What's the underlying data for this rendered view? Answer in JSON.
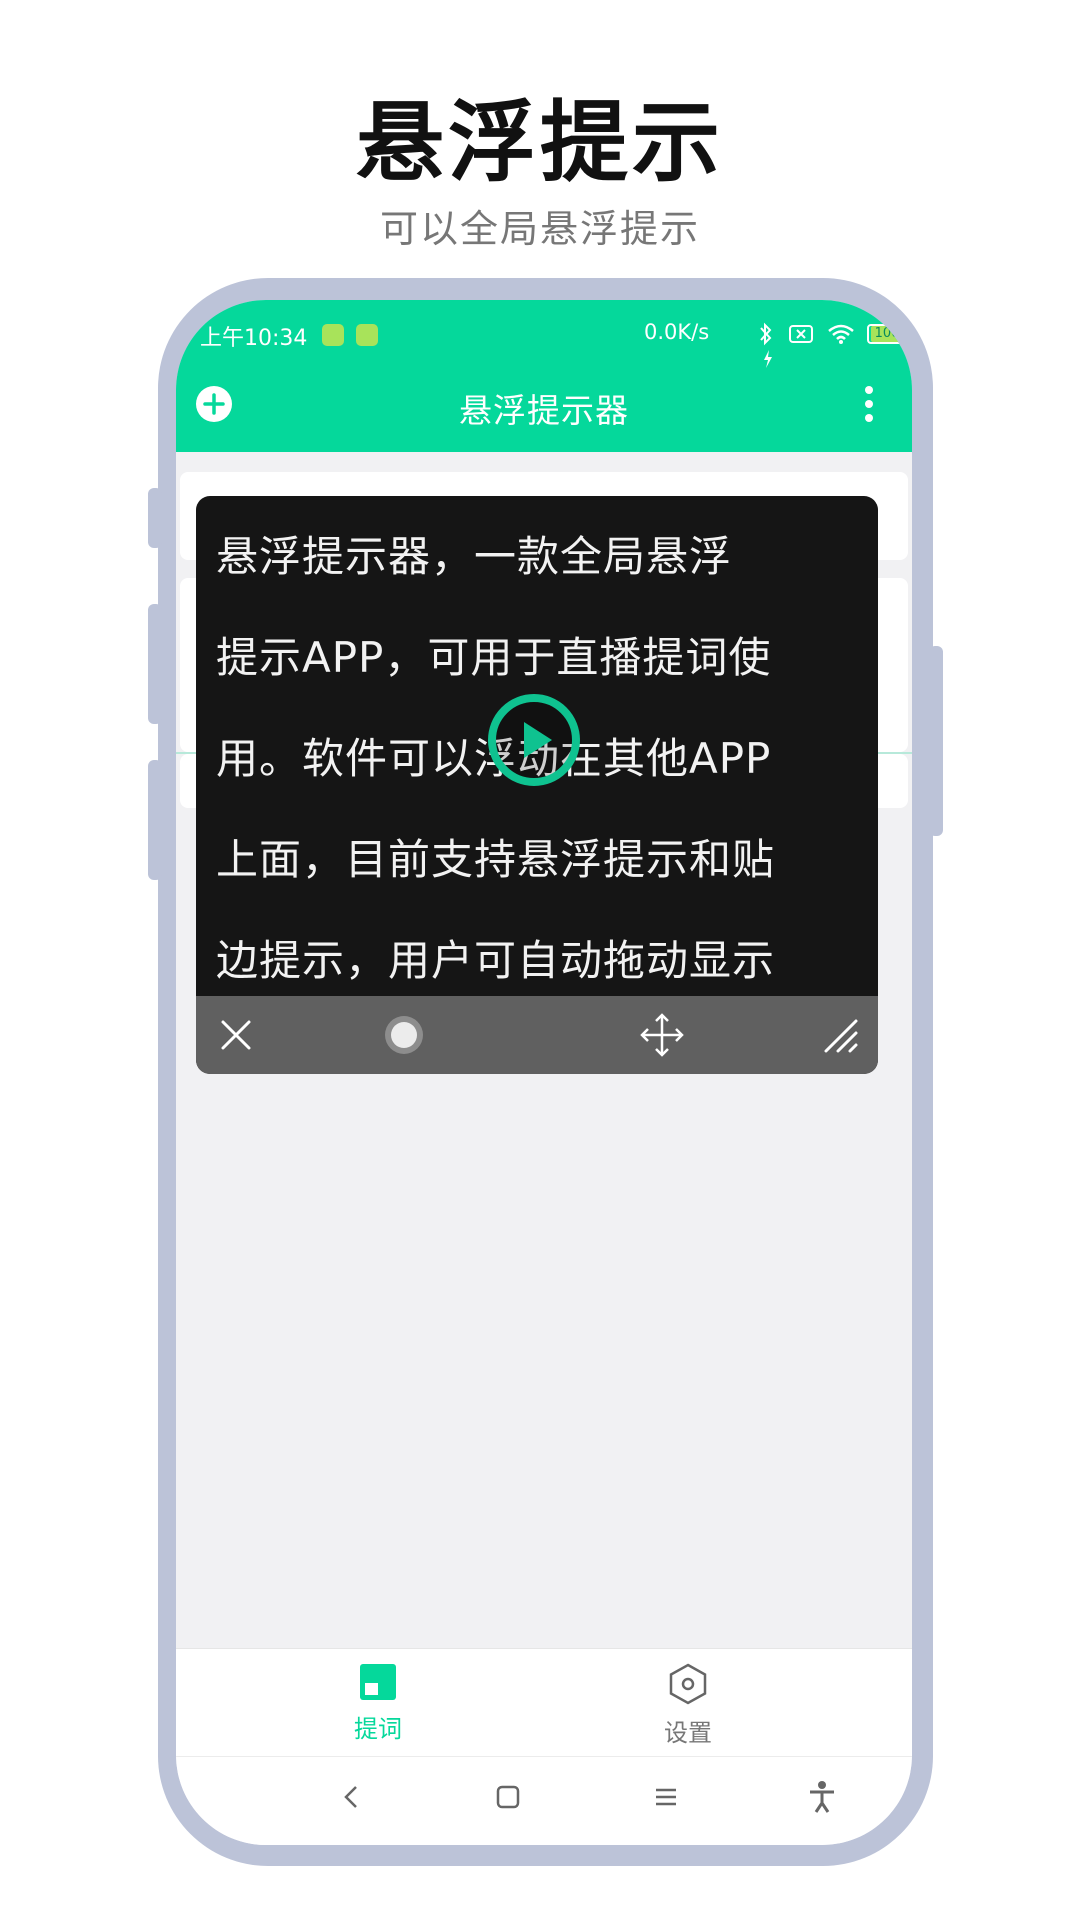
{
  "headline": "悬浮提示",
  "subline": "可以全局悬浮提示",
  "status_bar": {
    "time": "上午10:34",
    "network_speed": "0.0K/s",
    "battery": "100",
    "icons": [
      "bot-icon",
      "bot-icon",
      "bluetooth-icon",
      "sim-off-icon",
      "wifi-icon",
      "battery-icon",
      "charging-icon"
    ]
  },
  "app_bar": {
    "title": "悬浮提示器",
    "add_icon": "plus-circle-icon",
    "menu_icon": "more-vertical-icon"
  },
  "floating_prompter": {
    "lines": [
      "悬浮提示器，一款全局悬浮",
      "提示APP，可用于直播提词使",
      "用。软件可以浮动在其他APP",
      "上面，目前支持悬浮提示和贴",
      "边提示，用户可自动拖动显示"
    ],
    "controls": [
      "close-icon",
      "record-toggle-icon",
      "move-icon",
      "resize-icon"
    ]
  },
  "bottom_nav": {
    "items": [
      {
        "label": "提词",
        "icon": "prompt-icon",
        "active": true
      },
      {
        "label": "设置",
        "icon": "settings-hex-icon",
        "active": false
      }
    ]
  },
  "system_nav": [
    "back-icon",
    "home-icon",
    "recents-icon",
    "accessibility-icon"
  ],
  "colors": {
    "accent": "#05d89b",
    "phone_frame": "#bcc3d8",
    "overlay_bg": "#151515",
    "overlay_bar": "#606060",
    "screen_bg": "#f1f1f3"
  }
}
